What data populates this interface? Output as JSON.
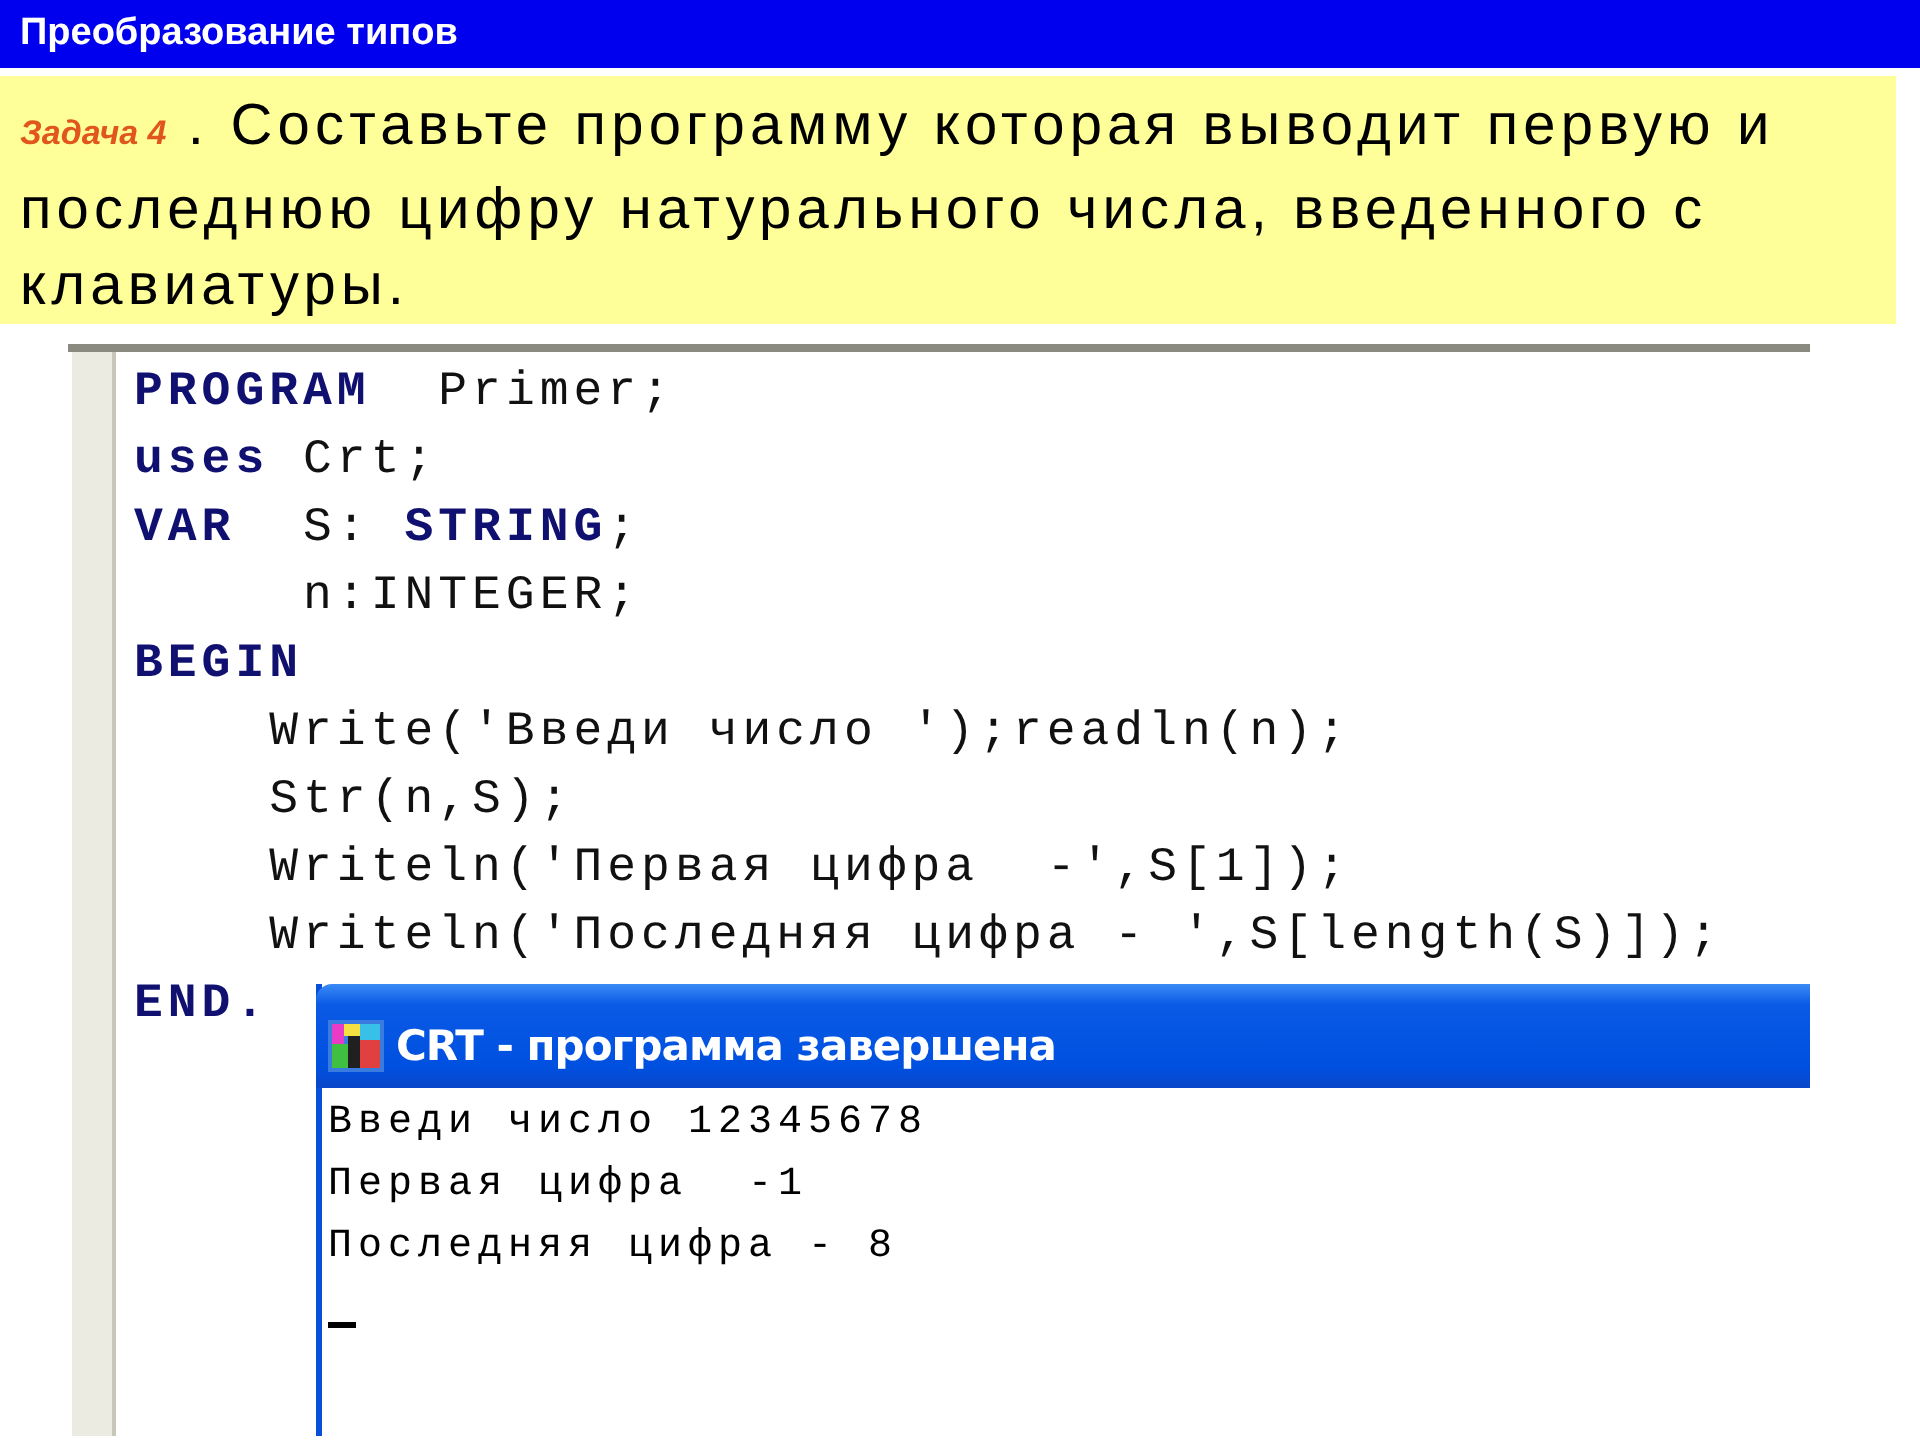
{
  "slide_title": "Преобразование типов",
  "task": {
    "label": "Задача 4",
    "text": ". Составьте программу которая выводит первую и последнюю цифру натурального числа, введенного с клавиатуры."
  },
  "editor": {
    "lines": [
      "**PROGRAM**  Primer;",
      "**uses** Crt;",
      "**VAR**  S: **STRING**;",
      "     n:INTEGER;",
      "**BEGIN**",
      "    Write('Введи число ');readln(n);",
      "    Str(n,S);",
      "    Writeln('Первая цифра  -',S[1]);",
      "    Writeln('Последняя цифра - ',S[length(S)]);",
      "**END.**"
    ]
  },
  "console_window": {
    "title": "CRT - программа завершена",
    "lines": [
      "Введи число 12345678",
      "Первая цифра  -1",
      "Последняя цифра - 8"
    ],
    "cursor": true
  }
}
